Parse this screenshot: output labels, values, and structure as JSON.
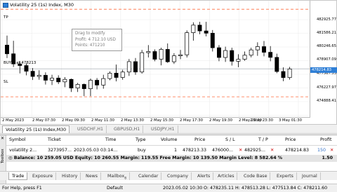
{
  "chart": {
    "title": "Volatility 25 (1s) Index, M30",
    "tp_label": "TP",
    "sl_label": "SL",
    "buy_label": "BUY 1 at 478213",
    "tooltip": {
      "line1": "Drag to modify",
      "line2": "Profit: 4 712.10 USD",
      "line3": "Points: 471210"
    },
    "price_ticks": [
      "482925.77",
      "481586.21",
      "480246.65",
      "478907.09",
      "477567.53",
      "476227.97",
      "474888.41"
    ],
    "current_price": "478214.83",
    "time_ticks": [
      "2 May 2023",
      "2 May 07:30",
      "2 May 09:30",
      "2 May 11:30",
      "2 May 13:30",
      "2 May 15:30",
      "2 May 17:30",
      "2 May 19:30",
      "2 May 21:30",
      "2 May 23:30",
      "3 May 01:30"
    ],
    "colors": {
      "bull": "#ffffff",
      "bear": "#000000",
      "tp_sl_line": "#ff6a3c",
      "buy_line": "#9aa0a8",
      "price_tag": "#2f7fd6"
    }
  },
  "chart_tabs": [
    "Volatility 25 (1s) Index,M30",
    "USDCHF,H1",
    "GBPUSD,H1",
    "USDJPY,H1"
  ],
  "trade_table": {
    "headers": [
      "Symbol",
      "Ticket",
      "Time",
      "Type",
      "Volume",
      "Price",
      "S / L",
      "T / P",
      "Price",
      "Profit"
    ],
    "row": [
      "volatility 2...",
      "3273957...",
      "2023.05.03 03:14...",
      "buy",
      "1",
      "478213.33",
      "476000...",
      "482925...",
      "478214.83",
      "150"
    ],
    "balance_text": "Balance: 10 259.05 USD  Equity: 10 260.55  Margin: 119.55  Free Margin: 10 139.50  Margin Level: 8 582.64 %",
    "balance_profit": "1.50"
  },
  "toolbox_label": "Toolbox",
  "terminal_tabs": [
    "Trade",
    "Exposure",
    "History",
    "News",
    "Mailbox",
    "Calendar",
    "Company",
    "Alerts",
    "Articles",
    "Code Base",
    "Experts",
    "Journal"
  ],
  "mailbox_badge": "8",
  "statusbar": {
    "help": "For Help, press F1",
    "profile": "Default",
    "datetime": "2023.05.02 10:30",
    "ohlc": "O: 478235.11  H: 478513.28  L: 477513.84  C: 478211.60"
  },
  "candles": [
    {
      "o": 480090,
      "h": 480840,
      "l": 479060,
      "c": 479400
    },
    {
      "o": 479400,
      "h": 480430,
      "l": 478360,
      "c": 478600
    },
    {
      "o": 478600,
      "h": 478810,
      "l": 477850,
      "c": 478470
    },
    {
      "o": 478470,
      "h": 478640,
      "l": 477700,
      "c": 478020
    },
    {
      "o": 478020,
      "h": 478270,
      "l": 477330,
      "c": 477610
    },
    {
      "o": 477610,
      "h": 478100,
      "l": 477350,
      "c": 477700
    },
    {
      "o": 477700,
      "h": 477930,
      "l": 476970,
      "c": 477310
    },
    {
      "o": 477310,
      "h": 477740,
      "l": 476930,
      "c": 477480
    },
    {
      "o": 477480,
      "h": 477700,
      "l": 477010,
      "c": 477180
    },
    {
      "o": 477180,
      "h": 477560,
      "l": 476760,
      "c": 477380
    },
    {
      "o": 477380,
      "h": 477440,
      "l": 476380,
      "c": 476690
    },
    {
      "o": 476690,
      "h": 477100,
      "l": 476380,
      "c": 476980
    },
    {
      "o": 476980,
      "h": 477050,
      "l": 476050,
      "c": 476640
    },
    {
      "o": 476640,
      "h": 477440,
      "l": 476050,
      "c": 477310
    },
    {
      "o": 477310,
      "h": 477480,
      "l": 476590,
      "c": 476930
    },
    {
      "o": 476930,
      "h": 477740,
      "l": 476640,
      "c": 477440
    },
    {
      "o": 477440,
      "h": 478010,
      "l": 477310,
      "c": 477870
    },
    {
      "o": 477870,
      "h": 478550,
      "l": 477220,
      "c": 477530
    },
    {
      "o": 477530,
      "h": 478140,
      "l": 477350,
      "c": 477960
    },
    {
      "o": 477960,
      "h": 478990,
      "l": 477650,
      "c": 478780
    },
    {
      "o": 478780,
      "h": 479070,
      "l": 477740,
      "c": 477960
    },
    {
      "o": 477960,
      "h": 479710,
      "l": 477830,
      "c": 479490
    },
    {
      "o": 479490,
      "h": 480090,
      "l": 479110,
      "c": 479580
    },
    {
      "o": 479580,
      "h": 479750,
      "l": 478810,
      "c": 478970
    },
    {
      "o": 478970,
      "h": 479880,
      "l": 478490,
      "c": 479750
    },
    {
      "o": 479750,
      "h": 480220,
      "l": 478680,
      "c": 478770
    },
    {
      "o": 478770,
      "h": 479450,
      "l": 478600,
      "c": 479240
    },
    {
      "o": 479240,
      "h": 479710,
      "l": 478980,
      "c": 479320
    },
    {
      "o": 479320,
      "h": 481250,
      "l": 479110,
      "c": 481070
    },
    {
      "o": 481070,
      "h": 481890,
      "l": 480440,
      "c": 481670
    },
    {
      "o": 481670,
      "h": 481930,
      "l": 480950,
      "c": 481210
    },
    {
      "o": 481210,
      "h": 481930,
      "l": 480780,
      "c": 481030
    },
    {
      "o": 481030,
      "h": 481280,
      "l": 479580,
      "c": 479880
    },
    {
      "o": 479880,
      "h": 480090,
      "l": 478810,
      "c": 479110
    },
    {
      "o": 479110,
      "h": 479960,
      "l": 478760,
      "c": 479660
    },
    {
      "o": 479660,
      "h": 479880,
      "l": 478470,
      "c": 478810
    },
    {
      "o": 478810,
      "h": 479370,
      "l": 478340,
      "c": 478970
    },
    {
      "o": 478970,
      "h": 479580,
      "l": 478850,
      "c": 479290
    },
    {
      "o": 479290,
      "h": 479880,
      "l": 479120,
      "c": 479710
    },
    {
      "o": 479710,
      "h": 480310,
      "l": 479240,
      "c": 479970
    },
    {
      "o": 479970,
      "h": 480410,
      "l": 479200,
      "c": 479520
    },
    {
      "o": 479520,
      "h": 480010,
      "l": 478810,
      "c": 479120
    },
    {
      "o": 479120,
      "h": 479410,
      "l": 477870,
      "c": 478000
    },
    {
      "o": 478000,
      "h": 478330,
      "l": 477230,
      "c": 477520
    },
    {
      "o": 477520,
      "h": 478360,
      "l": 477360,
      "c": 478200
    }
  ],
  "price_axis": {
    "min": 474400,
    "max": 483600
  },
  "levels": {
    "tp": 482925.77,
    "sl": 476000,
    "buy": 478213.33
  }
}
